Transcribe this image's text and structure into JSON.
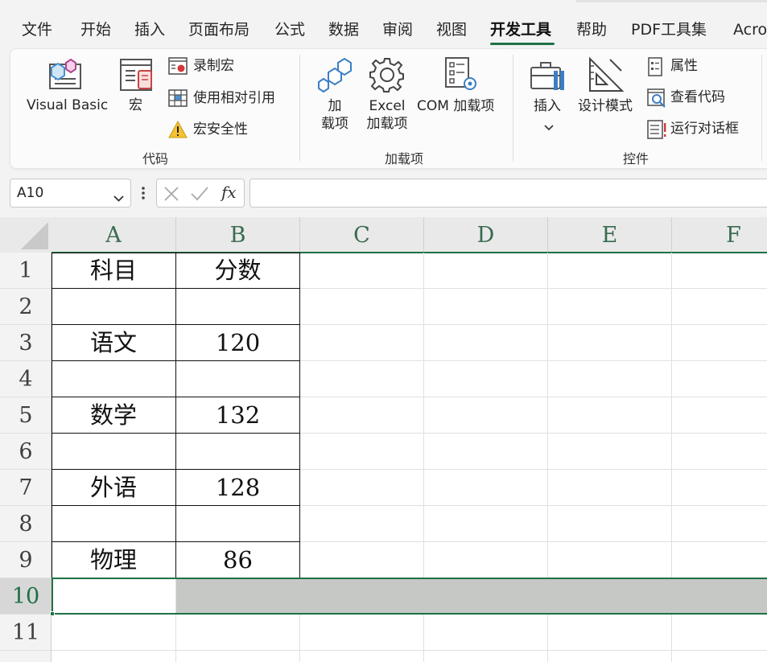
{
  "menu": {
    "tabs": [
      "文件",
      "开始",
      "插入",
      "页面布局",
      "公式",
      "数据",
      "审阅",
      "视图",
      "开发工具",
      "帮助",
      "PDF工具集",
      "Acro"
    ],
    "active": "开发工具"
  },
  "ribbon": {
    "code": {
      "group_label": "代码",
      "visual_basic": "Visual Basic",
      "macros": "宏",
      "record_macro": "录制宏",
      "relative_refs": "使用相对引用",
      "macro_security": "宏安全性"
    },
    "addins": {
      "group_label": "加载项",
      "addins_line1": "加",
      "addins_line2": "载项",
      "excel_line1": "Excel",
      "excel_line2": "加载项",
      "com_addins": "COM 加载项"
    },
    "controls": {
      "group_label": "控件",
      "insert": "插入",
      "design_mode": "设计模式",
      "properties": "属性",
      "view_code": "查看代码",
      "run_dialog": "运行对话框"
    }
  },
  "formula_bar": {
    "name_box": "A10",
    "fx_label": "fx",
    "formula": ""
  },
  "sheet": {
    "columns": [
      "A",
      "B",
      "C",
      "D",
      "E",
      "F"
    ],
    "rows": [
      "1",
      "2",
      "3",
      "4",
      "5",
      "6",
      "7",
      "8",
      "9",
      "10",
      "11"
    ],
    "selected_row": "10",
    "cells": [
      [
        "科目",
        "分数"
      ],
      [
        "",
        ""
      ],
      [
        "语文",
        "120"
      ],
      [
        "",
        ""
      ],
      [
        "数学",
        "132"
      ],
      [
        "",
        ""
      ],
      [
        "外语",
        "128"
      ],
      [
        "",
        ""
      ],
      [
        "物理",
        "86"
      ]
    ]
  },
  "colors": {
    "accent": "#1e7145",
    "selection_fill": "#c6c8c6"
  }
}
